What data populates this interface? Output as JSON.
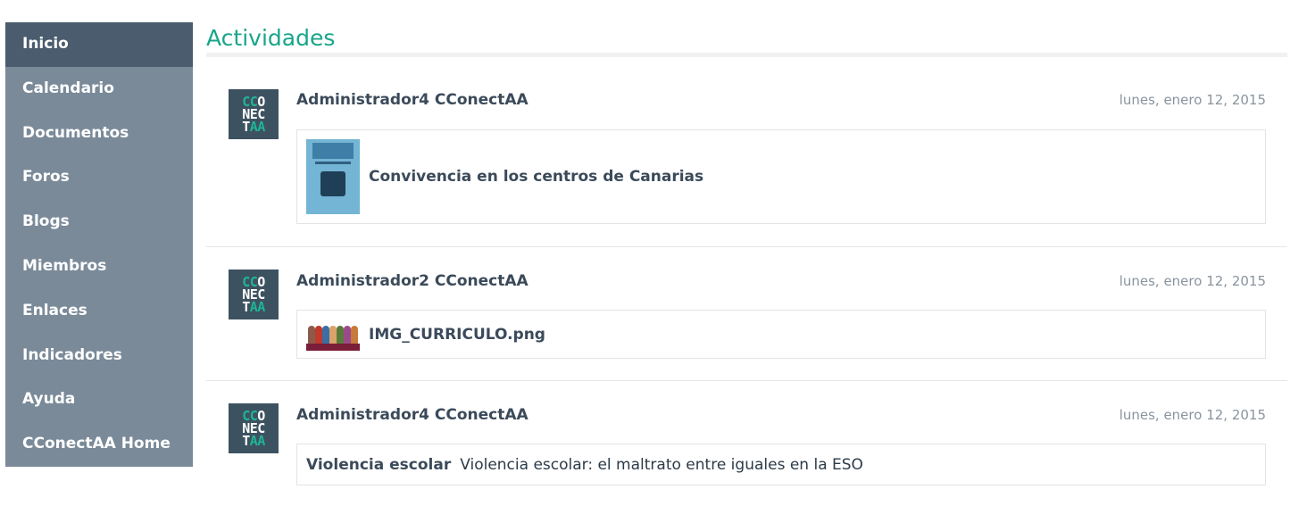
{
  "sidebar": {
    "items": [
      {
        "label": "Inicio",
        "active": true
      },
      {
        "label": "Calendario"
      },
      {
        "label": "Documentos"
      },
      {
        "label": "Foros"
      },
      {
        "label": "Blogs"
      },
      {
        "label": "Miembros"
      },
      {
        "label": "Enlaces"
      },
      {
        "label": "Indicadores"
      },
      {
        "label": "Ayuda"
      },
      {
        "label": "CConectAA Home"
      }
    ]
  },
  "main": {
    "title": "Actividades",
    "avatar_logo": [
      "CC",
      "O",
      "NEC",
      "T",
      "AA"
    ],
    "activities": [
      {
        "author": "Administrador4 CConectAA",
        "date": "lunes, enero 12, 2015",
        "attachment_title": "Convivencia en los centros de Canarias"
      },
      {
        "author": "Administrador2 CConectAA",
        "date": "lunes, enero 12, 2015",
        "attachment_title": "IMG_CURRICULO.png"
      },
      {
        "author": "Administrador4 CConectAA",
        "date": "lunes, enero 12, 2015",
        "link_title": "Violencia escolar",
        "link_description": "Violencia escolar: el maltrato entre iguales en la ESO"
      }
    ]
  },
  "colors": {
    "accent": "#19a58a",
    "sidebar_bg": "#7a8a99",
    "sidebar_active": "#4a5c6e",
    "avatar_bg": "#3d5261"
  }
}
